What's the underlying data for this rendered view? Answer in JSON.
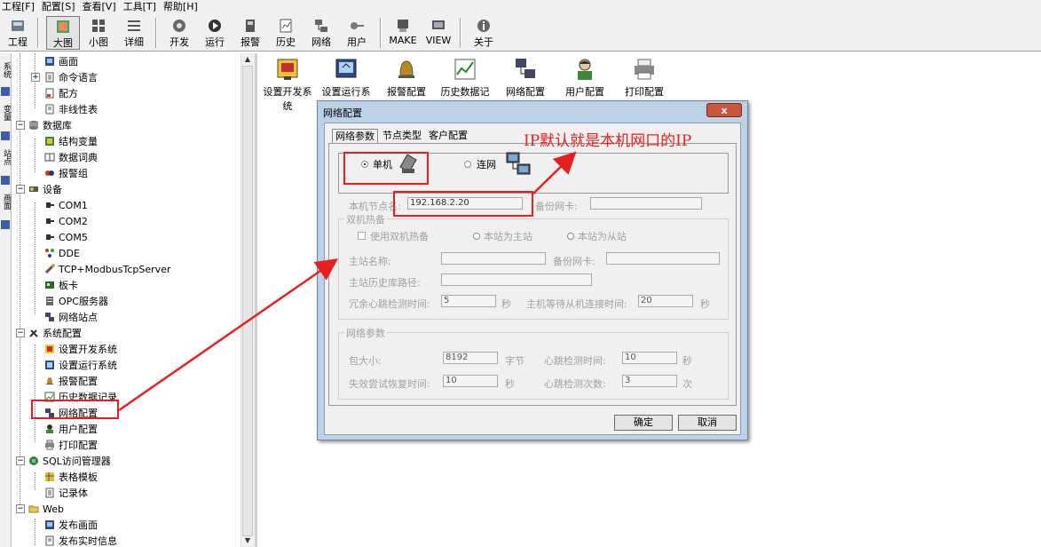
{
  "menu": [
    "工程[F]",
    "配置[S]",
    "查看[V]",
    "工具[T]",
    "帮助[H]"
  ],
  "toolbar": {
    "buttons": [
      {
        "id": "project",
        "label": "工程"
      },
      {
        "id": "large",
        "label": "大图"
      },
      {
        "id": "small",
        "label": "小图"
      },
      {
        "id": "detail",
        "label": "详细"
      },
      {
        "id": "develop",
        "label": "开发"
      },
      {
        "id": "run",
        "label": "运行"
      },
      {
        "id": "alarm",
        "label": "报警"
      },
      {
        "id": "history",
        "label": "历史"
      },
      {
        "id": "network",
        "label": "网络"
      },
      {
        "id": "user",
        "label": "用户"
      },
      {
        "id": "make",
        "label": "MAKE"
      },
      {
        "id": "view",
        "label": "VIEW"
      },
      {
        "id": "about",
        "label": "关于"
      }
    ]
  },
  "side_tabs": [
    "系统",
    "变量",
    "站点",
    "画面"
  ],
  "tree": {
    "items": [
      {
        "label": "画面"
      },
      {
        "label": "命令语言"
      },
      {
        "label": "配方"
      },
      {
        "label": "非线性表"
      },
      {
        "label": "数据库"
      },
      {
        "label": "结构变量"
      },
      {
        "label": "数据词典"
      },
      {
        "label": "报警组"
      },
      {
        "label": "设备"
      },
      {
        "label": "COM1"
      },
      {
        "label": "COM2"
      },
      {
        "label": "COM5"
      },
      {
        "label": "DDE"
      },
      {
        "label": "TCP+ModbusTcpServer"
      },
      {
        "label": "板卡"
      },
      {
        "label": "OPC服务器"
      },
      {
        "label": "网络站点"
      },
      {
        "label": "系统配置"
      },
      {
        "label": "设置开发系统"
      },
      {
        "label": "设置运行系统"
      },
      {
        "label": "报警配置"
      },
      {
        "label": "历史数据记录"
      },
      {
        "label": "网络配置"
      },
      {
        "label": "用户配置"
      },
      {
        "label": "打印配置"
      },
      {
        "label": "SQL访问管理器"
      },
      {
        "label": "表格模板"
      },
      {
        "label": "记录体"
      },
      {
        "label": "Web"
      },
      {
        "label": "发布画面"
      },
      {
        "label": "发布实时信息"
      }
    ]
  },
  "config_items": [
    {
      "label1": "设置开发系",
      "label2": "统"
    },
    {
      "label1": "设置运行系统",
      "label2": ""
    },
    {
      "label1": "报警配置",
      "label2": ""
    },
    {
      "label1": "历史数据记",
      "label2": ""
    },
    {
      "label1": "网络配置",
      "label2": ""
    },
    {
      "label1": "用户配置",
      "label2": ""
    },
    {
      "label1": "打印配置",
      "label2": ""
    }
  ],
  "dialog": {
    "title": "网络配置",
    "close": "x",
    "tabs": [
      "网络参数",
      "节点类型",
      "客户配置"
    ],
    "mode_standalone": "单机",
    "mode_network": "连网",
    "local_node_label": "本机节点名:",
    "local_node_value": "192.168.2.20",
    "backup_nic_label": "备份网卡:",
    "hot_standby": {
      "title": "双机热备",
      "use_label": "使用双机热备",
      "primary_label": "本站为主站",
      "secondary_label": "本站为从站",
      "master_name_label": "主站名称:",
      "backup_nic_label": "备份网卡:",
      "master_history_label": "主站历史库路径:",
      "heartbeat_label": "冗余心跳检测时间:",
      "heartbeat_value": "5",
      "heartbeat_unit": "秒",
      "wait_label": "主机等待从机连接时间:",
      "wait_value": "20",
      "wait_unit": "秒"
    },
    "net_params": {
      "title": "网络参数",
      "packet_label": "包大小:",
      "packet_value": "8192",
      "packet_unit": "字节",
      "hb_label": "心跳检测时间:",
      "hb_value": "10",
      "hb_unit": "秒",
      "retry_label": "失效尝试恢复时间:",
      "retry_value": "10",
      "retry_unit": "秒",
      "hb_count_label": "心跳检测次数:",
      "hb_count_value": "3",
      "hb_count_unit": "次"
    },
    "ok": "确定",
    "cancel": "取消"
  },
  "annotation": {
    "text": "IP默认就是本机网口的IP",
    "color": "#e62020"
  }
}
